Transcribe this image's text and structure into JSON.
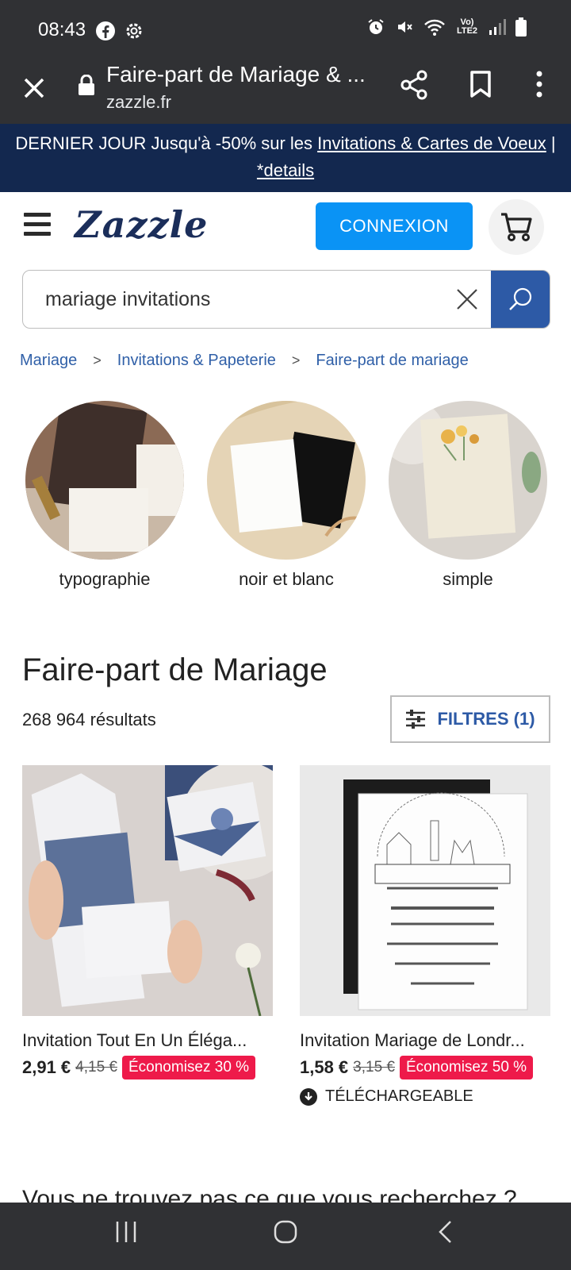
{
  "status_bar": {
    "time": "08:43",
    "network": "Vo) LTE2"
  },
  "browser": {
    "page_title": "Faire-part de Mariage & ...",
    "url": "zazzle.fr"
  },
  "promo": {
    "text_prefix": "DERNIER JOUR Jusqu'à -50% sur les ",
    "link1": "Invitations & Cartes de Voeux",
    "separator": " | ",
    "link2": "*details"
  },
  "header": {
    "logo": "Zazzle",
    "login_label": "CONNEXION"
  },
  "search": {
    "value": "mariage invitations"
  },
  "breadcrumb": {
    "items": [
      "Mariage",
      "Invitations & Papeterie",
      "Faire-part de mariage"
    ]
  },
  "categories": [
    {
      "label": "typographie"
    },
    {
      "label": "noir et blanc"
    },
    {
      "label": "simple"
    }
  ],
  "listing": {
    "heading": "Faire-part de Mariage",
    "results": "268 964 résultats",
    "filters_label": "FILTRES (1)"
  },
  "products": [
    {
      "name": "Invitation Tout En Un Éléga...",
      "price": "2,91 €",
      "old_price": "4,15 €",
      "badge": "Économisez 30 %"
    },
    {
      "name": "Invitation Mariage de Londr...",
      "price": "1,58 €",
      "old_price": "3,15 €",
      "badge": "Économisez 50 %",
      "download_label": "TÉLÉCHARGEABLE"
    }
  ],
  "footer_teaser": "Vous ne trouvez pas ce que vous recherchez ?",
  "colors": {
    "brand_navy": "#13284f",
    "login_blue": "#0a93f5",
    "search_blue": "#2d5aa6",
    "save_red": "#ee1a4a"
  }
}
